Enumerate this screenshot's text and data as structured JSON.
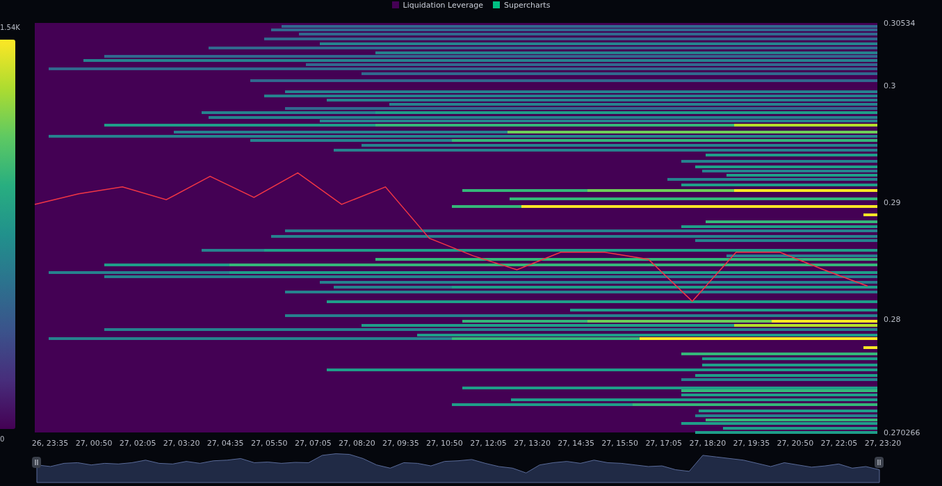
{
  "legend": [
    {
      "label": "Liquidation Leverage",
      "color": "#440154"
    },
    {
      "label": "Supercharts",
      "color": "#00c082"
    }
  ],
  "colorbar": {
    "max": "1.54K",
    "min": "0"
  },
  "chart_data": {
    "type": "line",
    "ylim": [
      0.270266,
      0.30534
    ],
    "yticks": [
      {
        "value": 0.30534,
        "label": "0.30534"
      },
      {
        "value": 0.3,
        "label": "0.3"
      },
      {
        "value": 0.29,
        "label": "0.29"
      },
      {
        "value": 0.28,
        "label": "0.28"
      },
      {
        "value": 0.270266,
        "label": "0.270266"
      }
    ],
    "categories": [
      "26, 23:35",
      "27, 00:50",
      "27, 02:05",
      "27, 03:20",
      "27, 04:35",
      "27, 05:50",
      "27, 07:05",
      "27, 08:20",
      "27, 09:35",
      "27, 10:50",
      "27, 12:05",
      "27, 13:20",
      "27, 14:35",
      "27, 15:50",
      "27, 17:05",
      "27, 18:20",
      "27, 19:35",
      "27, 20:50",
      "27, 22:05",
      "27, 23:20"
    ],
    "series": [
      {
        "color": "#f23645",
        "values": [
          0.2898,
          0.2907,
          0.2913,
          0.2902,
          0.2922,
          0.2904,
          0.2925,
          0.2898,
          0.2913,
          0.2869,
          0.2854,
          0.2842,
          0.2857,
          0.2857,
          0.2851,
          0.2815,
          0.2857,
          0.2857,
          0.2842,
          0.2828
        ]
      }
    ]
  }
}
